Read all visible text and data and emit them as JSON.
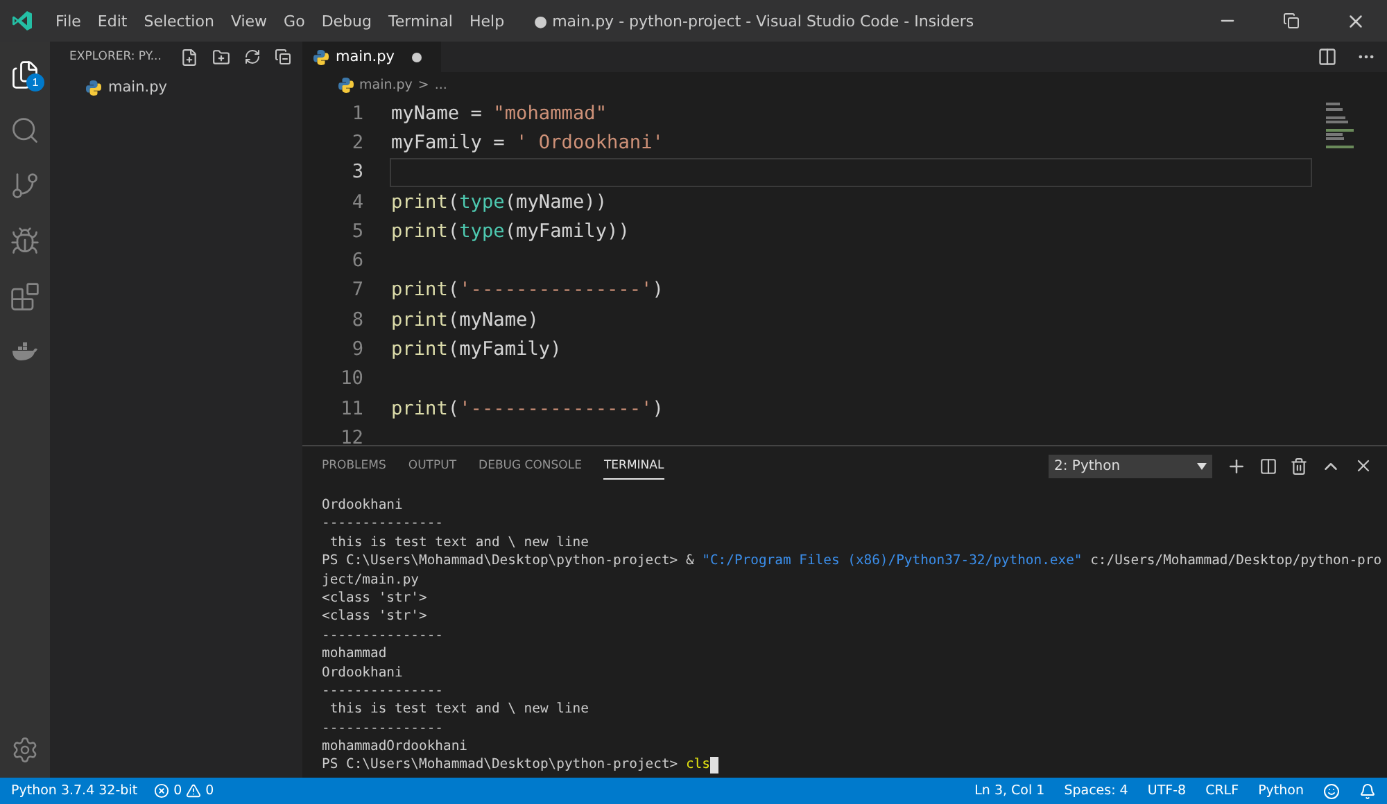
{
  "window": {
    "title": "● main.py - python-project - Visual Studio Code - Insiders"
  },
  "menu": [
    "File",
    "Edit",
    "Selection",
    "View",
    "Go",
    "Debug",
    "Terminal",
    "Help"
  ],
  "activity_bar": [
    {
      "kind": "explorer",
      "selected": true,
      "badge": "1"
    },
    {
      "kind": "search",
      "selected": false
    },
    {
      "kind": "scm",
      "selected": false
    },
    {
      "kind": "debug",
      "selected": false
    },
    {
      "kind": "extensions",
      "selected": false
    },
    {
      "kind": "docker",
      "selected": false
    }
  ],
  "sidebar": {
    "title": "EXPLORER: PY...",
    "files": [
      "main.py"
    ]
  },
  "editor_tabs": [
    {
      "label": "main.py",
      "modified": true,
      "selected": true
    }
  ],
  "breadcrumb": {
    "file": "main.py",
    "separator": ">",
    "rest": "..."
  },
  "code": [
    {
      "number": "1",
      "current": false,
      "tokens": [
        {
          "text": "myName",
          "kind": "var"
        },
        {
          "text": " = ",
          "kind": "op"
        },
        {
          "text": "\"mohammad\"",
          "kind": "string"
        }
      ]
    },
    {
      "number": "2",
      "current": false,
      "tokens": [
        {
          "text": "myFamily",
          "kind": "var"
        },
        {
          "text": " = ",
          "kind": "op"
        },
        {
          "text": "' Ordookhani'",
          "kind": "string"
        }
      ]
    },
    {
      "number": "3",
      "current": true
    },
    {
      "number": "4",
      "current": false,
      "tokens": [
        {
          "text": "print",
          "kind": "func"
        },
        {
          "text": "(",
          "kind": "op"
        },
        {
          "text": "type",
          "kind": "builtin"
        },
        {
          "text": "(myName))",
          "kind": "var"
        }
      ]
    },
    {
      "number": "5",
      "current": false,
      "tokens": [
        {
          "text": "print",
          "kind": "func"
        },
        {
          "text": "(",
          "kind": "op"
        },
        {
          "text": "type",
          "kind": "builtin"
        },
        {
          "text": "(myFamily))",
          "kind": "var"
        }
      ]
    },
    {
      "number": "6",
      "current": false
    },
    {
      "number": "7",
      "current": false,
      "tokens": [
        {
          "text": "print",
          "kind": "func"
        },
        {
          "text": "(",
          "kind": "op"
        },
        {
          "text": "'---------------'",
          "kind": "string"
        },
        {
          "text": ")",
          "kind": "op"
        }
      ]
    },
    {
      "number": "8",
      "current": false,
      "tokens": [
        {
          "text": "print",
          "kind": "func"
        },
        {
          "text": "(myName)",
          "kind": "var"
        }
      ]
    },
    {
      "number": "9",
      "current": false,
      "tokens": [
        {
          "text": "print",
          "kind": "func"
        },
        {
          "text": "(myFamily)",
          "kind": "var"
        }
      ]
    },
    {
      "number": "10",
      "current": false
    },
    {
      "number": "11",
      "current": false,
      "tokens": [
        {
          "text": "print",
          "kind": "func"
        },
        {
          "text": "(",
          "kind": "op"
        },
        {
          "text": "'---------------'",
          "kind": "string"
        },
        {
          "text": ")",
          "kind": "op"
        }
      ]
    },
    {
      "number": "12",
      "current": false
    }
  ],
  "panel": {
    "tabs": [
      {
        "label": "PROBLEMS",
        "selected": false
      },
      {
        "label": "OUTPUT",
        "selected": false
      },
      {
        "label": "DEBUG CONSOLE",
        "selected": false
      },
      {
        "label": "TERMINAL",
        "selected": true
      }
    ],
    "terminal_select": "2: Python",
    "terminal": [
      [
        {
          "text": "Ordookhani",
          "kind": "plain"
        }
      ],
      [
        {
          "text": "---------------",
          "kind": "plain"
        }
      ],
      [
        {
          "text": " this is test text and \\ new line",
          "kind": "plain"
        }
      ],
      [
        {
          "text": "PS C:\\Users\\Mohammad\\Desktop\\python-project> & ",
          "kind": "plain"
        },
        {
          "text": "\"C:/Program Files (x86)/Python37-32/python.exe\"",
          "kind": "path"
        },
        {
          "text": " c:/Users/Mohammad/Desktop/python-pro",
          "kind": "plain"
        }
      ],
      [
        {
          "text": "ject/main.py",
          "kind": "plain"
        }
      ],
      [
        {
          "text": "<class 'str'>",
          "kind": "plain"
        }
      ],
      [
        {
          "text": "<class 'str'>",
          "kind": "plain"
        }
      ],
      [
        {
          "text": "---------------",
          "kind": "plain"
        }
      ],
      [
        {
          "text": "mohammad",
          "kind": "plain"
        }
      ],
      [
        {
          "text": "Ordookhani",
          "kind": "plain"
        }
      ],
      [
        {
          "text": "---------------",
          "kind": "plain"
        }
      ],
      [
        {
          "text": " this is test text and \\ new line",
          "kind": "plain"
        }
      ],
      [
        {
          "text": "---------------",
          "kind": "plain"
        }
      ],
      [
        {
          "text": "mohammadOrdookhani",
          "kind": "plain"
        }
      ],
      [
        {
          "text": "PS C:\\Users\\Mohammad\\Desktop\\python-project> ",
          "kind": "plain"
        },
        {
          "text": "cls",
          "kind": "command"
        }
      ]
    ]
  },
  "status_bar": {
    "interpreter": "Python 3.7.4 32-bit",
    "errors": "0",
    "warnings": "0",
    "right": [
      "Ln 3, Col 1",
      "Spaces: 4",
      "UTF-8",
      "CRLF",
      "Python"
    ]
  }
}
